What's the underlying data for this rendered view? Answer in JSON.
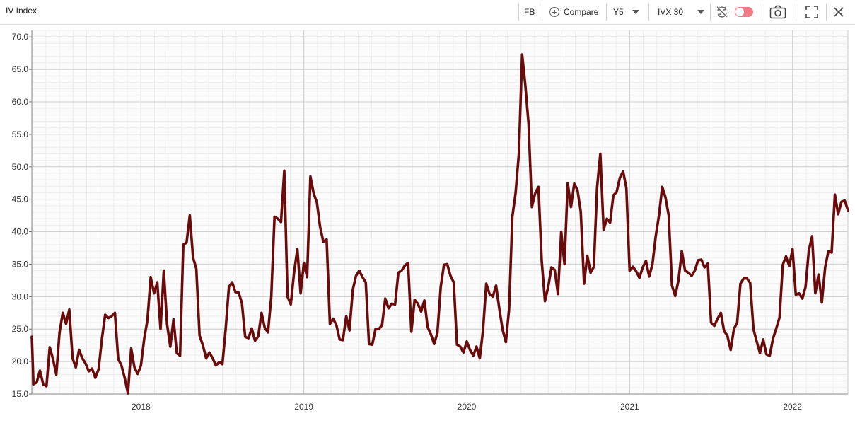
{
  "header": {
    "title": "IV Index",
    "ticker": "FB",
    "compare_label": "Compare",
    "period": "Y5",
    "measure": "IVX 30"
  },
  "icons": {
    "compare": "plus-circle-icon",
    "sync": "sync-disabled-icon",
    "toggle": "toggle-switch-icon",
    "camera": "camera-icon",
    "fullscreen": "fullscreen-icon",
    "close": "close-icon"
  },
  "colors": {
    "series": "#6b0a0a",
    "toggle": "#f07b85"
  },
  "chart_data": {
    "type": "line",
    "title": "",
    "xlabel": "",
    "ylabel": "",
    "ylim": [
      15,
      71
    ],
    "y_ticks": [
      "15.0",
      "20.0",
      "25.0",
      "30.0",
      "35.0",
      "40.0",
      "45.0",
      "50.0",
      "55.0",
      "60.0",
      "65.0",
      "70.0"
    ],
    "x_range": [
      2017.33,
      2022.34
    ],
    "x_ticks": [
      {
        "label": "2018",
        "x": 2018
      },
      {
        "label": "2019",
        "x": 2019
      },
      {
        "label": "2020",
        "x": 2020
      },
      {
        "label": "2021",
        "x": 2021
      },
      {
        "label": "2022",
        "x": 2022
      }
    ],
    "grid": true,
    "series": [
      {
        "name": "",
        "points": [
          [
            2017.33,
            23.8
          ],
          [
            2017.34,
            16.5
          ],
          [
            2017.36,
            16.8
          ],
          [
            2017.38,
            18.6
          ],
          [
            2017.4,
            16.5
          ],
          [
            2017.42,
            16.2
          ],
          [
            2017.44,
            22.2
          ],
          [
            2017.46,
            20.4
          ],
          [
            2017.48,
            18.0
          ],
          [
            2017.5,
            24.5
          ],
          [
            2017.52,
            27.5
          ],
          [
            2017.54,
            25.8
          ],
          [
            2017.56,
            28.0
          ],
          [
            2017.58,
            20.5
          ],
          [
            2017.6,
            19.1
          ],
          [
            2017.62,
            21.8
          ],
          [
            2017.64,
            20.5
          ],
          [
            2017.66,
            19.7
          ],
          [
            2017.68,
            18.5
          ],
          [
            2017.7,
            18.9
          ],
          [
            2017.72,
            17.5
          ],
          [
            2017.74,
            18.8
          ],
          [
            2017.76,
            23.4
          ],
          [
            2017.78,
            27.2
          ],
          [
            2017.8,
            26.7
          ],
          [
            2017.82,
            27.0
          ],
          [
            2017.84,
            27.5
          ],
          [
            2017.86,
            20.4
          ],
          [
            2017.88,
            19.4
          ],
          [
            2017.9,
            17.5
          ],
          [
            2017.92,
            15.1
          ],
          [
            2017.94,
            22.0
          ],
          [
            2017.96,
            19.1
          ],
          [
            2017.98,
            18.1
          ],
          [
            2018.0,
            19.4
          ],
          [
            2018.02,
            23.5
          ],
          [
            2018.04,
            26.4
          ],
          [
            2018.06,
            33.0
          ],
          [
            2018.08,
            30.5
          ],
          [
            2018.1,
            32.2
          ],
          [
            2018.12,
            25.0
          ],
          [
            2018.14,
            34.0
          ],
          [
            2018.16,
            25.8
          ],
          [
            2018.18,
            22.3
          ],
          [
            2018.2,
            26.5
          ],
          [
            2018.22,
            21.3
          ],
          [
            2018.24,
            20.9
          ],
          [
            2018.26,
            38.0
          ],
          [
            2018.28,
            38.3
          ],
          [
            2018.3,
            42.5
          ],
          [
            2018.32,
            36.0
          ],
          [
            2018.34,
            34.3
          ],
          [
            2018.36,
            24.0
          ],
          [
            2018.38,
            22.5
          ],
          [
            2018.4,
            20.5
          ],
          [
            2018.42,
            21.4
          ],
          [
            2018.44,
            20.5
          ],
          [
            2018.46,
            19.4
          ],
          [
            2018.48,
            19.9
          ],
          [
            2018.5,
            19.6
          ],
          [
            2018.52,
            25.0
          ],
          [
            2018.54,
            31.5
          ],
          [
            2018.56,
            32.2
          ],
          [
            2018.58,
            30.7
          ],
          [
            2018.6,
            30.6
          ],
          [
            2018.62,
            29.0
          ],
          [
            2018.64,
            23.8
          ],
          [
            2018.66,
            23.6
          ],
          [
            2018.68,
            25.1
          ],
          [
            2018.7,
            23.2
          ],
          [
            2018.72,
            23.9
          ],
          [
            2018.74,
            27.5
          ],
          [
            2018.76,
            25.2
          ],
          [
            2018.78,
            24.5
          ],
          [
            2018.8,
            30.0
          ],
          [
            2018.82,
            42.3
          ],
          [
            2018.84,
            42.0
          ],
          [
            2018.86,
            41.5
          ],
          [
            2018.88,
            49.4
          ],
          [
            2018.9,
            30.0
          ],
          [
            2018.92,
            28.8
          ],
          [
            2018.94,
            33.7
          ],
          [
            2018.96,
            37.3
          ],
          [
            2018.98,
            30.5
          ],
          [
            2019.0,
            35.2
          ],
          [
            2019.02,
            33.0
          ],
          [
            2019.04,
            48.5
          ],
          [
            2019.06,
            45.9
          ],
          [
            2019.08,
            44.5
          ],
          [
            2019.1,
            40.7
          ],
          [
            2019.12,
            38.4
          ],
          [
            2019.14,
            38.8
          ],
          [
            2019.16,
            25.8
          ],
          [
            2019.18,
            26.6
          ],
          [
            2019.2,
            25.6
          ],
          [
            2019.22,
            23.4
          ],
          [
            2019.24,
            23.3
          ],
          [
            2019.26,
            27.0
          ],
          [
            2019.28,
            24.8
          ],
          [
            2019.3,
            31.0
          ],
          [
            2019.32,
            33.2
          ],
          [
            2019.34,
            34.0
          ],
          [
            2019.36,
            33.0
          ],
          [
            2019.38,
            32.2
          ],
          [
            2019.4,
            22.7
          ],
          [
            2019.42,
            22.6
          ],
          [
            2019.44,
            25.0
          ],
          [
            2019.46,
            25.0
          ],
          [
            2019.48,
            25.6
          ],
          [
            2019.5,
            29.7
          ],
          [
            2019.52,
            28.2
          ],
          [
            2019.54,
            28.9
          ],
          [
            2019.56,
            28.8
          ],
          [
            2019.58,
            33.7
          ],
          [
            2019.6,
            34.0
          ],
          [
            2019.62,
            34.8
          ],
          [
            2019.64,
            35.2
          ],
          [
            2019.66,
            24.6
          ],
          [
            2019.68,
            29.5
          ],
          [
            2019.7,
            28.9
          ],
          [
            2019.72,
            27.7
          ],
          [
            2019.74,
            29.4
          ],
          [
            2019.76,
            25.3
          ],
          [
            2019.78,
            24.2
          ],
          [
            2019.8,
            22.7
          ],
          [
            2019.82,
            24.4
          ],
          [
            2019.84,
            31.5
          ],
          [
            2019.86,
            34.9
          ],
          [
            2019.88,
            35.0
          ],
          [
            2019.9,
            33.2
          ],
          [
            2019.92,
            32.2
          ],
          [
            2019.94,
            22.6
          ],
          [
            2019.96,
            22.3
          ],
          [
            2019.98,
            21.4
          ],
          [
            2020.0,
            23.1
          ],
          [
            2020.02,
            21.8
          ],
          [
            2020.04,
            20.9
          ],
          [
            2020.06,
            22.3
          ],
          [
            2020.08,
            20.5
          ],
          [
            2020.1,
            24.8
          ],
          [
            2020.12,
            32.0
          ],
          [
            2020.14,
            30.4
          ],
          [
            2020.16,
            30.0
          ],
          [
            2020.18,
            31.7
          ],
          [
            2020.2,
            28.1
          ],
          [
            2020.22,
            24.9
          ],
          [
            2020.24,
            23.0
          ],
          [
            2020.26,
            28.1
          ],
          [
            2020.28,
            42.3
          ],
          [
            2020.3,
            46.0
          ],
          [
            2020.32,
            52.0
          ],
          [
            2020.34,
            67.3
          ],
          [
            2020.36,
            62.5
          ],
          [
            2020.38,
            56.5
          ],
          [
            2020.4,
            43.8
          ],
          [
            2020.42,
            45.9
          ],
          [
            2020.44,
            46.9
          ],
          [
            2020.46,
            35.5
          ],
          [
            2020.48,
            29.3
          ],
          [
            2020.5,
            31.5
          ],
          [
            2020.52,
            34.5
          ],
          [
            2020.54,
            34.1
          ],
          [
            2020.56,
            30.4
          ],
          [
            2020.58,
            40.0
          ],
          [
            2020.6,
            35.0
          ],
          [
            2020.62,
            47.5
          ],
          [
            2020.64,
            43.8
          ],
          [
            2020.66,
            47.4
          ],
          [
            2020.68,
            46.4
          ],
          [
            2020.7,
            43.1
          ],
          [
            2020.72,
            32.0
          ],
          [
            2020.74,
            36.3
          ],
          [
            2020.76,
            33.7
          ],
          [
            2020.78,
            34.6
          ],
          [
            2020.8,
            46.8
          ],
          [
            2020.82,
            52.0
          ],
          [
            2020.84,
            40.3
          ],
          [
            2020.86,
            42.0
          ],
          [
            2020.88,
            41.4
          ],
          [
            2020.9,
            45.6
          ],
          [
            2020.92,
            46.1
          ],
          [
            2020.94,
            48.3
          ],
          [
            2020.96,
            49.3
          ],
          [
            2020.98,
            46.7
          ],
          [
            2021.0,
            34.0
          ],
          [
            2021.02,
            34.6
          ],
          [
            2021.04,
            33.9
          ],
          [
            2021.06,
            32.9
          ],
          [
            2021.08,
            34.5
          ],
          [
            2021.1,
            35.5
          ],
          [
            2021.12,
            33.1
          ],
          [
            2021.14,
            35.0
          ],
          [
            2021.16,
            39.3
          ],
          [
            2021.18,
            42.5
          ],
          [
            2021.2,
            46.9
          ],
          [
            2021.22,
            45.3
          ],
          [
            2021.24,
            42.5
          ],
          [
            2021.26,
            31.7
          ],
          [
            2021.28,
            30.1
          ],
          [
            2021.3,
            32.5
          ],
          [
            2021.32,
            37.0
          ],
          [
            2021.34,
            34.0
          ],
          [
            2021.36,
            33.7
          ],
          [
            2021.38,
            33.2
          ],
          [
            2021.4,
            34.0
          ],
          [
            2021.42,
            35.6
          ],
          [
            2021.44,
            35.7
          ],
          [
            2021.46,
            34.5
          ],
          [
            2021.48,
            35.1
          ],
          [
            2021.5,
            26.0
          ],
          [
            2021.52,
            25.5
          ],
          [
            2021.54,
            26.6
          ],
          [
            2021.56,
            27.5
          ],
          [
            2021.58,
            24.7
          ],
          [
            2021.6,
            24.0
          ],
          [
            2021.62,
            21.8
          ],
          [
            2021.64,
            25.0
          ],
          [
            2021.66,
            26.0
          ],
          [
            2021.68,
            32.0
          ],
          [
            2021.7,
            32.8
          ],
          [
            2021.72,
            32.8
          ],
          [
            2021.74,
            32.1
          ],
          [
            2021.76,
            25.0
          ],
          [
            2021.78,
            23.1
          ],
          [
            2021.8,
            21.3
          ],
          [
            2021.82,
            23.4
          ],
          [
            2021.84,
            21.1
          ],
          [
            2021.86,
            20.9
          ],
          [
            2021.88,
            23.5
          ],
          [
            2021.9,
            25.1
          ],
          [
            2021.92,
            26.8
          ],
          [
            2021.94,
            34.9
          ],
          [
            2021.96,
            36.2
          ],
          [
            2021.98,
            34.7
          ],
          [
            2022.0,
            37.3
          ],
          [
            2022.02,
            30.3
          ],
          [
            2022.04,
            30.5
          ],
          [
            2022.06,
            29.7
          ],
          [
            2022.08,
            31.5
          ],
          [
            2022.1,
            37.1
          ],
          [
            2022.12,
            39.3
          ],
          [
            2022.14,
            30.5
          ],
          [
            2022.16,
            33.4
          ],
          [
            2022.18,
            29.1
          ],
          [
            2022.2,
            34.5
          ],
          [
            2022.22,
            37.0
          ],
          [
            2022.24,
            36.8
          ],
          [
            2022.26,
            45.7
          ],
          [
            2022.28,
            42.7
          ],
          [
            2022.3,
            44.6
          ],
          [
            2022.32,
            44.8
          ],
          [
            2022.34,
            43.3
          ]
        ]
      }
    ]
  }
}
